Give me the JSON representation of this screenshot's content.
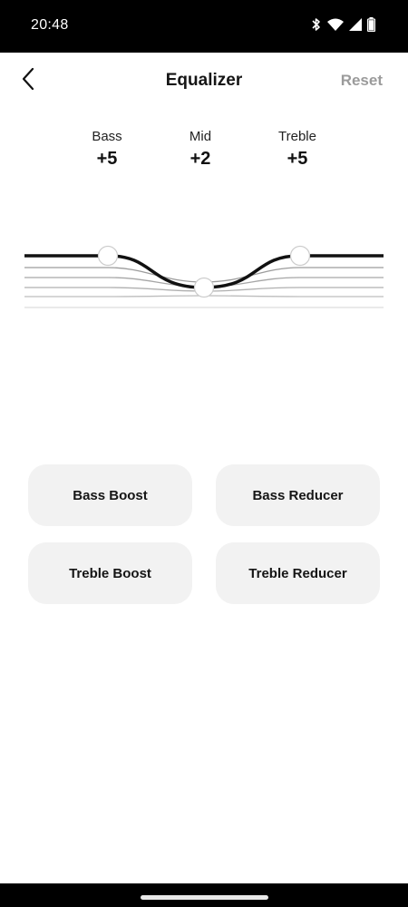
{
  "status_bar": {
    "time": "20:48",
    "icons": [
      "bluetooth-icon",
      "wifi-icon",
      "signal-icon",
      "battery-icon"
    ]
  },
  "header": {
    "title": "Equalizer",
    "back_icon": "chevron-left-icon",
    "reset_label": "Reset"
  },
  "bands": [
    {
      "label": "Bass",
      "value": "+5"
    },
    {
      "label": "Mid",
      "value": "+2"
    },
    {
      "label": "Treble",
      "value": "+5"
    }
  ],
  "presets": [
    {
      "label": "Bass Boost"
    },
    {
      "label": "Bass Reducer"
    },
    {
      "label": "Treble Boost"
    },
    {
      "label": "Treble Reducer"
    }
  ],
  "colors": {
    "curve": "#111111",
    "grid_lines": "#aaaaaa",
    "preset_background": "#f2f2f2",
    "reset_text": "#9b9b9b"
  }
}
